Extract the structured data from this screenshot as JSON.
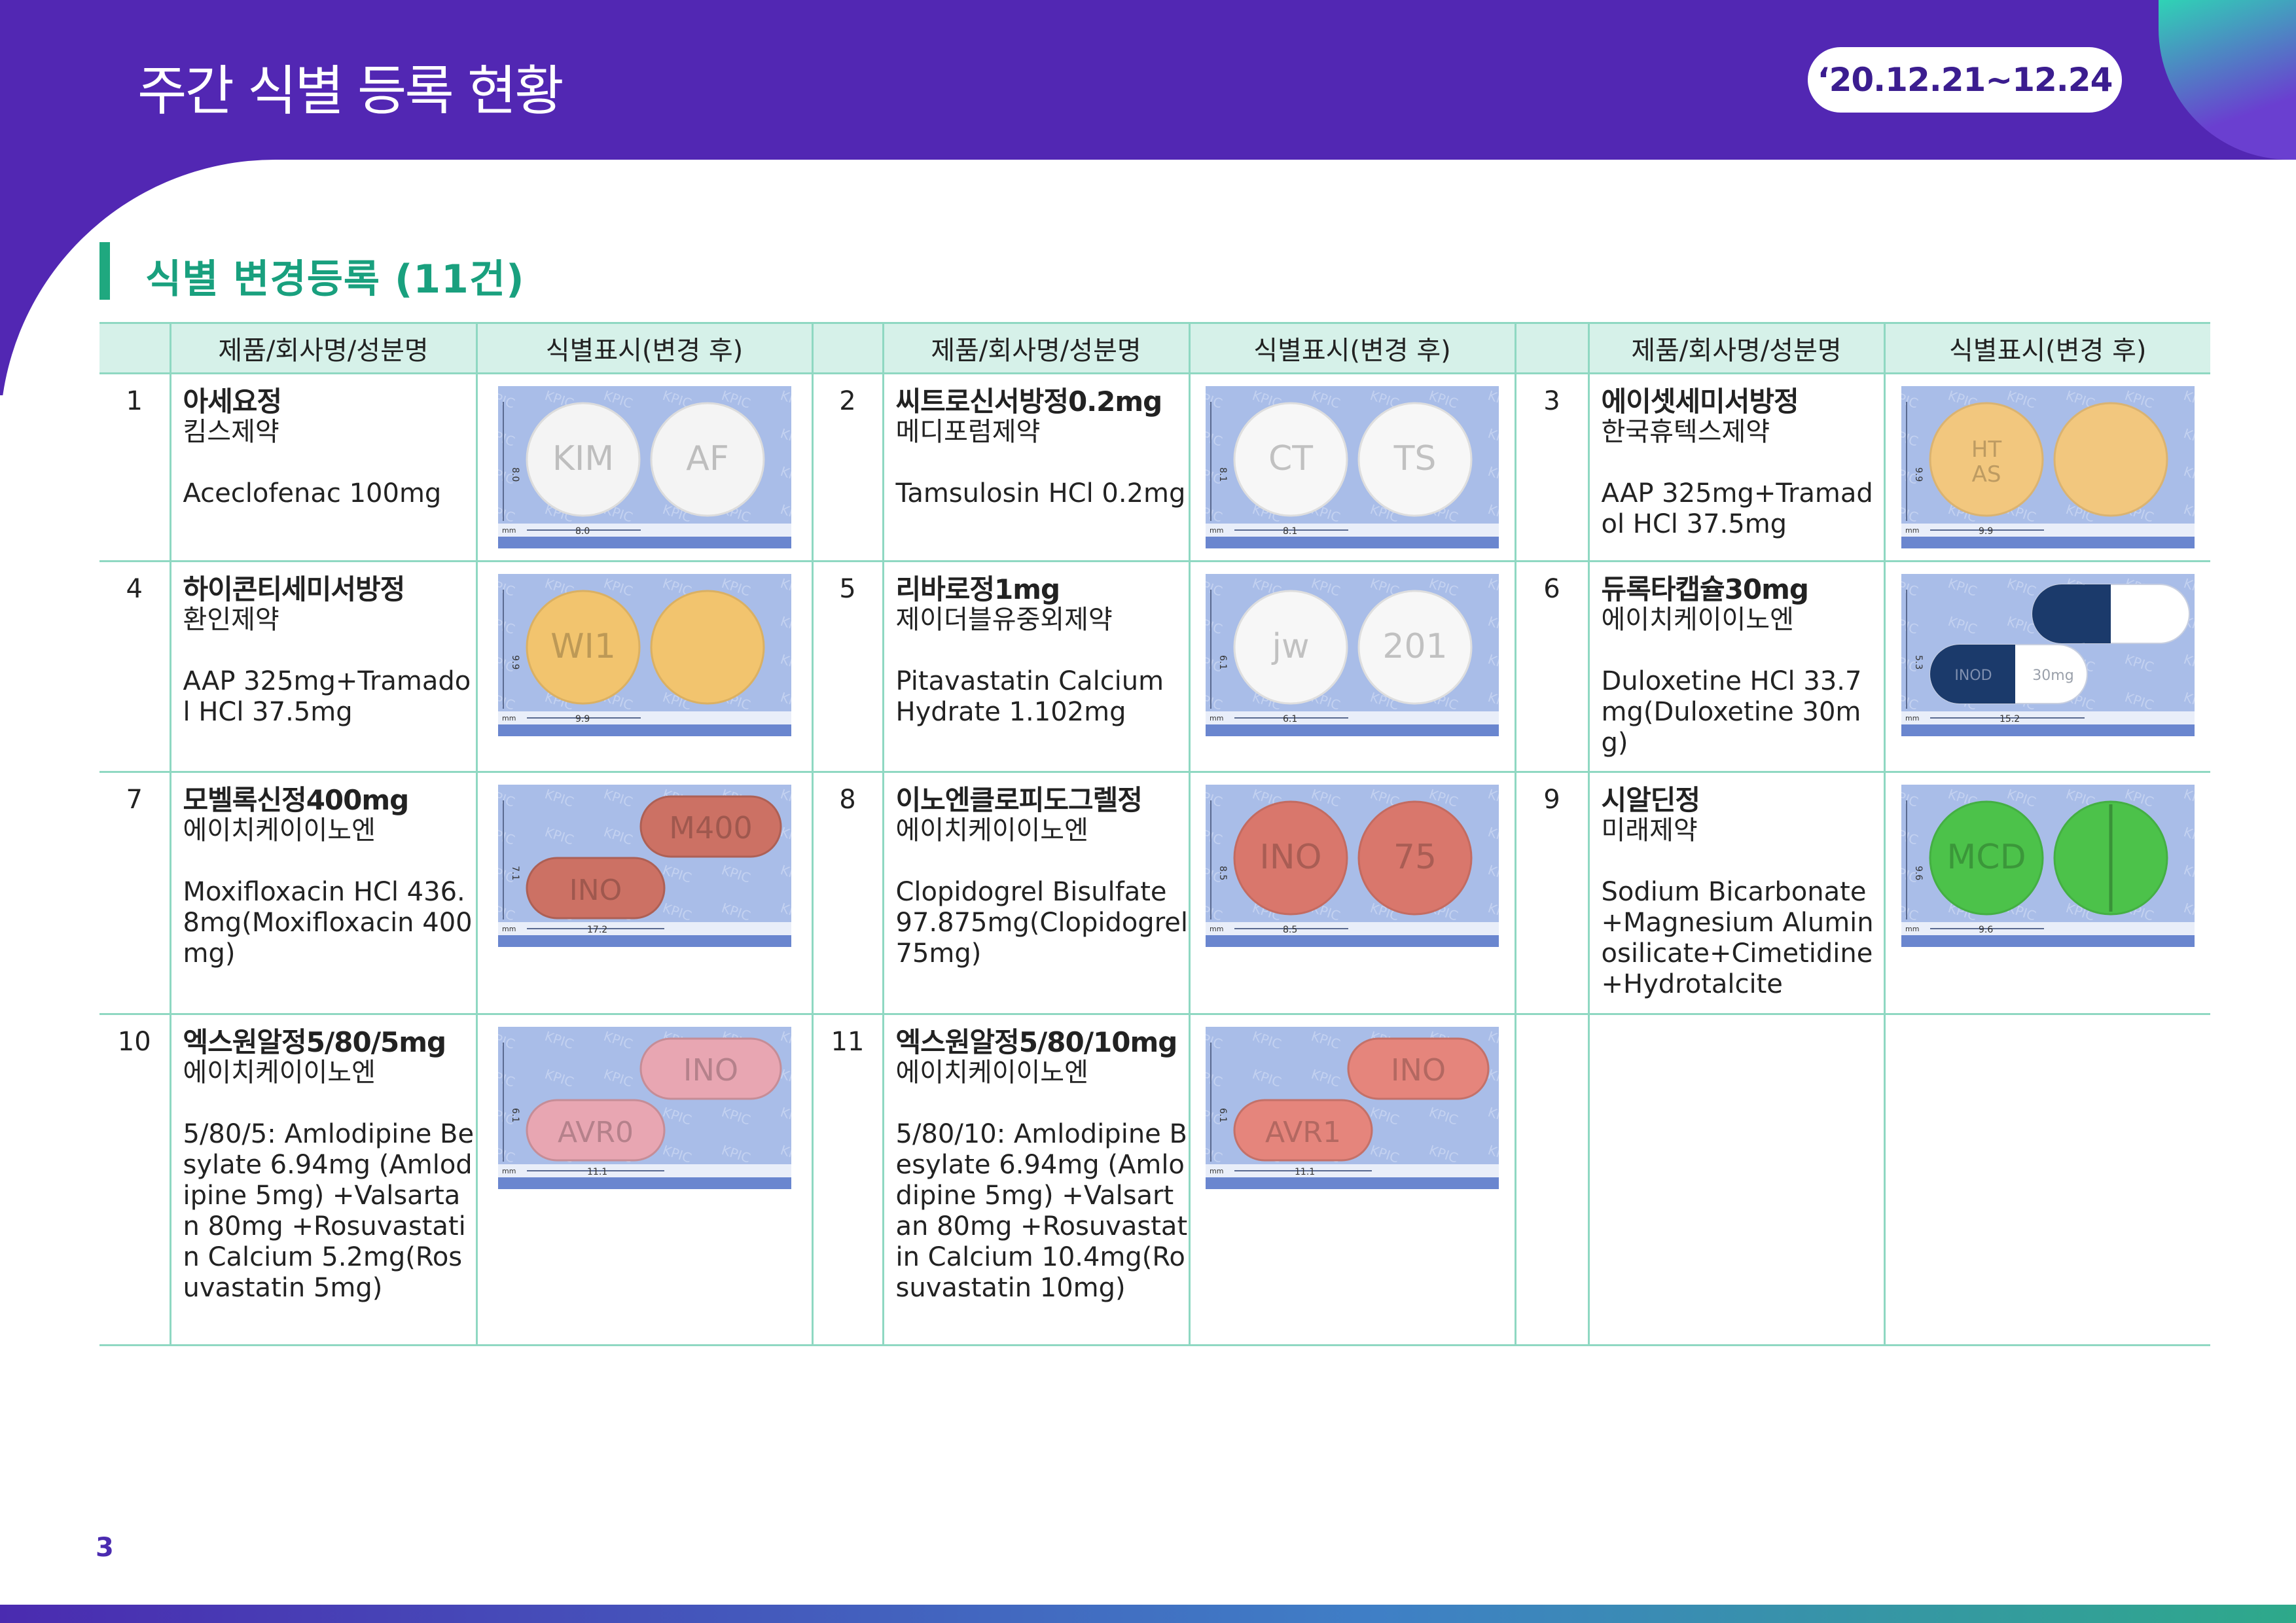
{
  "header": {
    "title": "주간 식별 등록 현황",
    "date_range": "‘20.12.21~12.24"
  },
  "section": {
    "title": "식별 변경등록 (11건)"
  },
  "table": {
    "col_product": "제품/회사명/성분명",
    "col_marking": "식별표시(변경 후)",
    "rows": [
      {
        "num": "1",
        "name": "아세요정",
        "company": "킴스제약",
        "ingredient": "Aceclofenac 100mg",
        "pill": {
          "shape": "round",
          "color": "#f4f4f4",
          "front": "KIM",
          "back": "AF",
          "size_label": "8.0",
          "height_label": "8.0"
        }
      },
      {
        "num": "2",
        "name": "씨트로신서방정0.2mg",
        "company": "메디포럼제약",
        "ingredient": "Tamsulosin HCl 0.2mg",
        "pill": {
          "shape": "round",
          "color": "#f7f7f7",
          "front": "CT",
          "back": "TS",
          "size_label": "8.1",
          "height_label": "8.1"
        }
      },
      {
        "num": "3",
        "name": "에이셋세미서방정",
        "company": "한국휴텍스제약",
        "ingredient": "AAP 325mg+Tramadol HCl 37.5mg",
        "pill": {
          "shape": "round",
          "color": "#f2c77e",
          "front": "HT AS",
          "back": "",
          "size_label": "9.9",
          "height_label": "9.9"
        }
      },
      {
        "num": "4",
        "name": "하이콘티세미서방정",
        "company": "환인제약",
        "ingredient": "AAP 325mg+Tramadol HCl 37.5mg",
        "pill": {
          "shape": "round",
          "color": "#f2c46e",
          "front": "WI1",
          "back": "",
          "size_label": "9.9",
          "height_label": "9.9"
        }
      },
      {
        "num": "5",
        "name": "리바로정1mg",
        "company": "제이더블유중외제약",
        "ingredient": "Pitavastatin Calcium Hydrate 1.102mg",
        "pill": {
          "shape": "round",
          "color": "#f7f7f7",
          "front": "jw",
          "back": "201",
          "size_label": "6.1",
          "height_label": "6.1"
        }
      },
      {
        "num": "6",
        "name": "듀록타캡슐30mg",
        "company": "에이치케이이노엔",
        "ingredient": "Duloxetine HCl 33.7mg(Duloxetine 30mg)",
        "pill": {
          "shape": "capsule",
          "color": "#1b3a6b",
          "front": "INOD",
          "back": "30mg",
          "size_label": "15.2",
          "height_label": "5.3"
        }
      },
      {
        "num": "7",
        "name": "모벨록신정400mg",
        "company": "에이치케이이노엔",
        "ingredient": "Moxifloxacin HCl 436.8mg(Moxifloxacin 400mg)",
        "pill": {
          "shape": "oblong",
          "color": "#cc7164",
          "front": "M400",
          "back": "INO",
          "size_label": "17.2",
          "height_label": "7.1"
        }
      },
      {
        "num": "8",
        "name": "이노엔클로피도그렐정",
        "company": "에이치케이이노엔",
        "ingredient": "Clopidogrel Bisulfate 97.875mg(Clopidogrel 75mg)",
        "pill": {
          "shape": "round",
          "color": "#d9776c",
          "front": "INO",
          "back": "75",
          "size_label": "8.5",
          "height_label": "8.5"
        }
      },
      {
        "num": "9",
        "name": "시알딘정",
        "company": "미래제약",
        "ingredient": "Sodium Bicarbonate +Magnesium Aluminosilicate+Cimetidine+Hydrotalcite",
        "pill": {
          "shape": "round",
          "color": "#4cc24a",
          "front": "MCD",
          "back": "",
          "size_label": "9.6",
          "height_label": "9.6"
        }
      },
      {
        "num": "10",
        "name": "엑스원알정5/80/5mg",
        "company": "에이치케이이노엔",
        "ingredient": "5/80/5: Amlodipine Besylate 6.94mg (Amlodipine 5mg) +Valsartan 80mg +Rosuvastatin Calcium 5.2mg(Rosuvastatin 5mg)",
        "pill": {
          "shape": "oblong",
          "color": "#e8a6b2",
          "front": "INO",
          "back": "AVR0",
          "size_label": "11.1",
          "height_label": "6.1"
        }
      },
      {
        "num": "11",
        "name": "엑스원알정5/80/10mg",
        "company": "에이치케이이노엔",
        "ingredient": "5/80/10: Amlodipine Besylate 6.94mg (Amlodipine 5mg) +Valsartan 80mg +Rosuvastatin Calcium 10.4mg(Rosuvastatin 10mg)",
        "pill": {
          "shape": "oblong",
          "color": "#e5857c",
          "front": "INO",
          "back": "AVR1",
          "size_label": "11.1",
          "height_label": "6.1"
        }
      }
    ]
  },
  "page_number": "3"
}
